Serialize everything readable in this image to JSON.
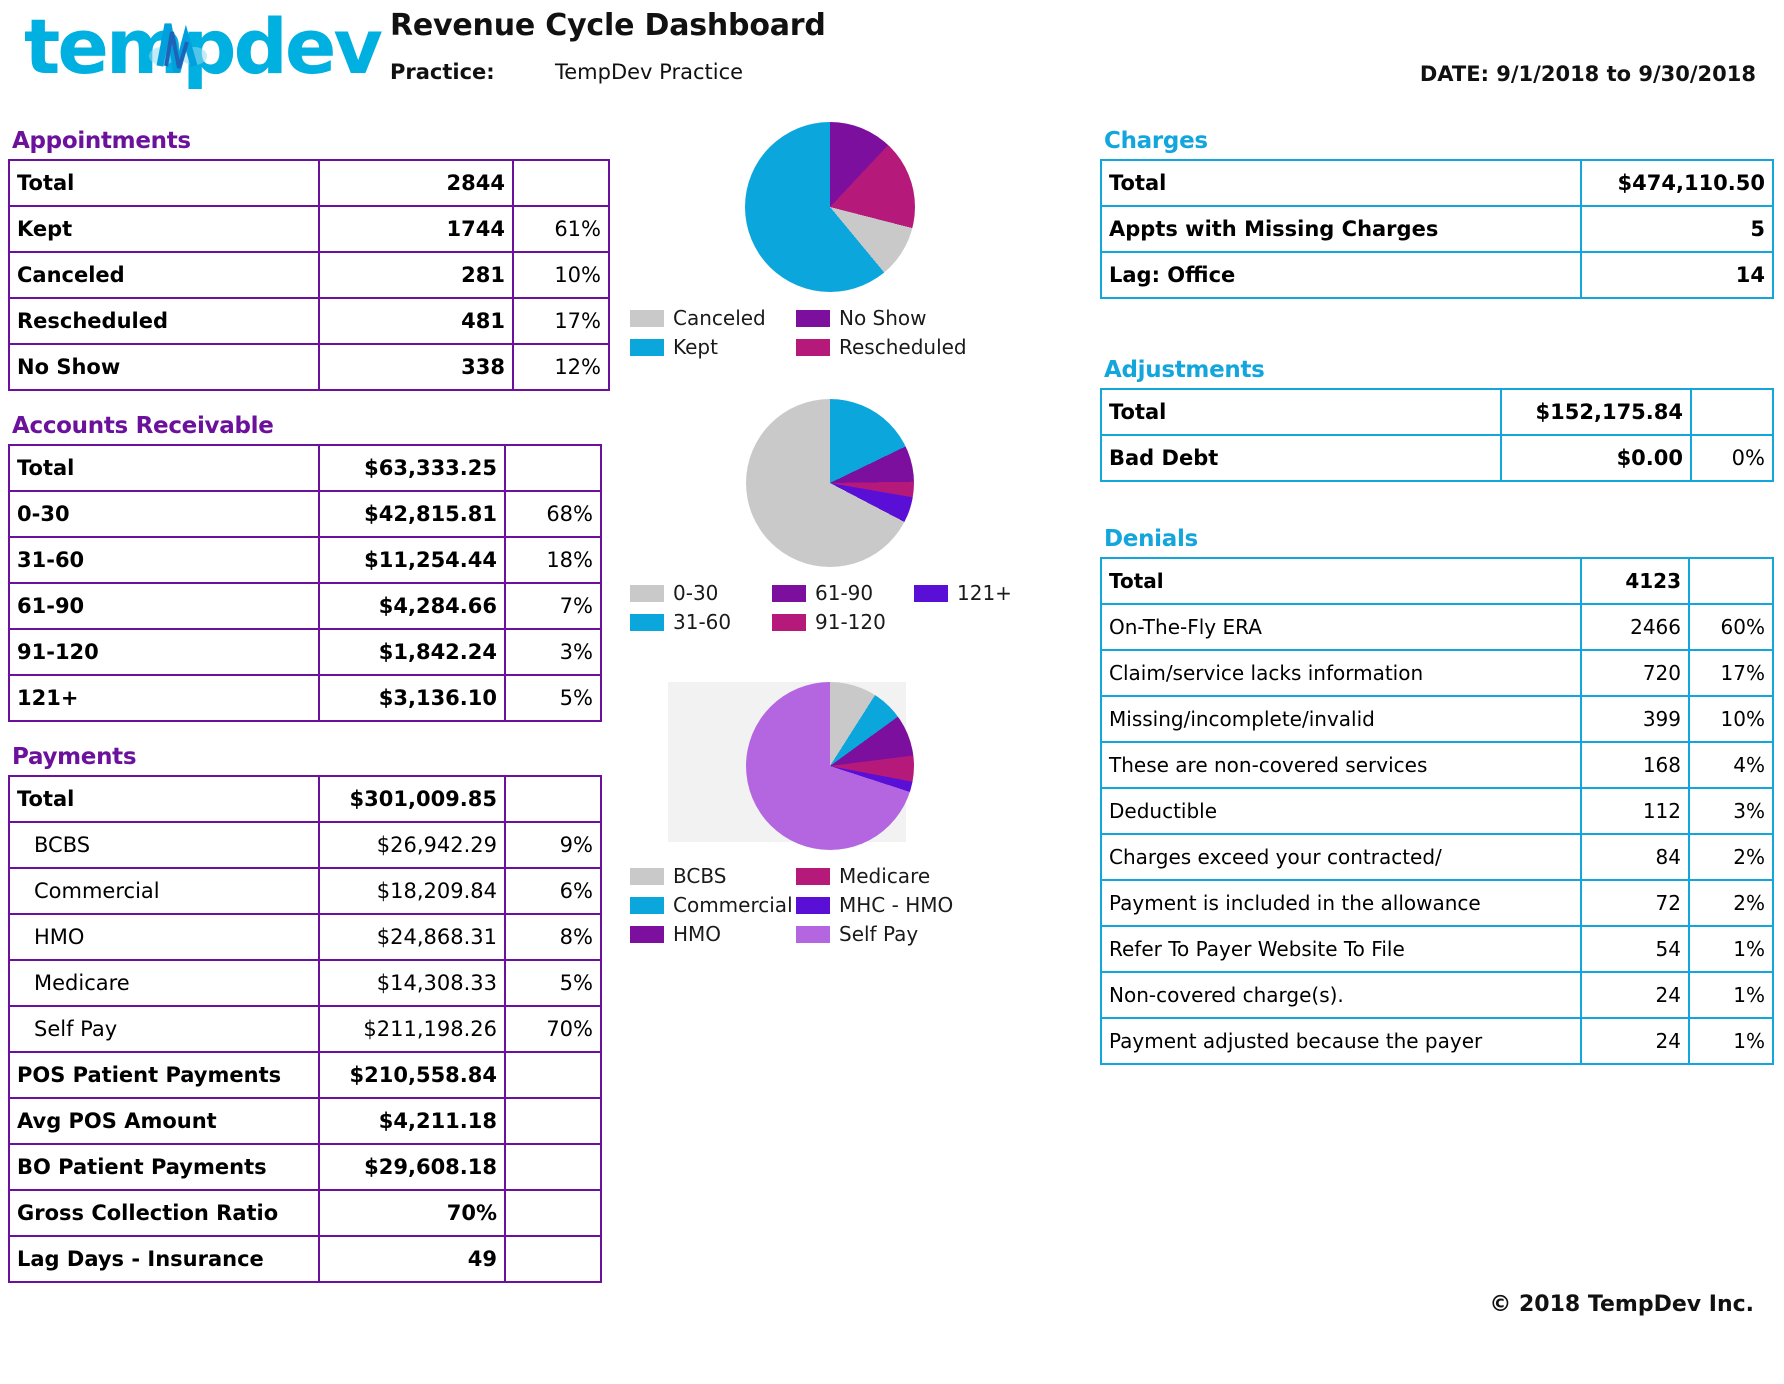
{
  "header": {
    "logo_text": "tempdev",
    "logo_icon": "heartbeat-wave-icon",
    "title": "Revenue Cycle Dashboard",
    "practice_label": "Practice:",
    "practice_value": "TempDev Practice",
    "date_range": "DATE: 9/1/2018 to 9/30/2018"
  },
  "colors": {
    "purple": "#6b119c",
    "cyan": "#13a6dd",
    "gray": "#c9c9c9",
    "magenta": "#b5197a",
    "violet": "#5a0fd6",
    "light_purple": "#b466e0",
    "hmo_purple": "#7d0f9e"
  },
  "appointments": {
    "heading": "Appointments",
    "rows": [
      {
        "label": "Total",
        "value": "2844",
        "pct": "",
        "bold": true
      },
      {
        "label": "Kept",
        "value": "1744",
        "pct": "61%",
        "bold": true
      },
      {
        "label": "Canceled",
        "value": "281",
        "pct": "10%",
        "bold": true
      },
      {
        "label": "Rescheduled",
        "value": "481",
        "pct": "17%",
        "bold": true
      },
      {
        "label": "No Show",
        "value": "338",
        "pct": "12%",
        "bold": true
      }
    ]
  },
  "accounts_receivable": {
    "heading": "Accounts Receivable",
    "rows": [
      {
        "label": "Total",
        "value": "$63,333.25",
        "pct": "",
        "bold": true
      },
      {
        "label": "0-30",
        "value": "$42,815.81",
        "pct": "68%",
        "bold": true
      },
      {
        "label": "31-60",
        "value": "$11,254.44",
        "pct": "18%",
        "bold": true
      },
      {
        "label": "61-90",
        "value": "$4,284.66",
        "pct": "7%",
        "bold": true
      },
      {
        "label": "91-120",
        "value": "$1,842.24",
        "pct": "3%",
        "bold": true
      },
      {
        "label": "121+",
        "value": "$3,136.10",
        "pct": "5%",
        "bold": true
      }
    ]
  },
  "payments": {
    "heading": "Payments",
    "rows": [
      {
        "label": "Total",
        "value": "$301,009.85",
        "pct": "",
        "bold": true,
        "indent": false
      },
      {
        "label": "BCBS",
        "value": "$26,942.29",
        "pct": "9%",
        "bold": false,
        "indent": true
      },
      {
        "label": "Commercial",
        "value": "$18,209.84",
        "pct": "6%",
        "bold": false,
        "indent": true
      },
      {
        "label": "HMO",
        "value": "$24,868.31",
        "pct": "8%",
        "bold": false,
        "indent": true
      },
      {
        "label": "Medicare",
        "value": "$14,308.33",
        "pct": "5%",
        "bold": false,
        "indent": true
      },
      {
        "label": "Self Pay",
        "value": "$211,198.26",
        "pct": "70%",
        "bold": false,
        "indent": true
      },
      {
        "label": "POS Patient Payments",
        "value": "$210,558.84",
        "pct": "",
        "bold": true,
        "indent": false
      },
      {
        "label": "Avg POS Amount",
        "value": "$4,211.18",
        "pct": "",
        "bold": true,
        "indent": false
      },
      {
        "label": "BO Patient Payments",
        "value": "$29,608.18",
        "pct": "",
        "bold": true,
        "indent": false
      },
      {
        "label": "Gross Collection Ratio",
        "value": "70%",
        "pct": "",
        "bold": true,
        "indent": false
      },
      {
        "label": "Lag Days - Insurance",
        "value": "49",
        "pct": "",
        "bold": true,
        "indent": false
      }
    ]
  },
  "charges": {
    "heading": "Charges",
    "rows": [
      {
        "label": "Total",
        "value": "$474,110.50",
        "bold": true
      },
      {
        "label": "Appts with Missing Charges",
        "value": "5",
        "bold": true
      },
      {
        "label": "Lag: Office",
        "value": "14",
        "bold": true
      }
    ]
  },
  "adjustments": {
    "heading": "Adjustments",
    "rows": [
      {
        "label": "Total",
        "value": "$152,175.84",
        "pct": "",
        "bold": true
      },
      {
        "label": "Bad Debt",
        "value": "$0.00",
        "pct": "0%",
        "bold": true
      }
    ]
  },
  "denials": {
    "heading": "Denials",
    "rows": [
      {
        "label": "Total",
        "value": "4123",
        "pct": "",
        "bold": true
      },
      {
        "label": "On-The-Fly ERA",
        "value": "2466",
        "pct": "60%",
        "bold": false
      },
      {
        "label": "Claim/service lacks information",
        "value": "720",
        "pct": "17%",
        "bold": false
      },
      {
        "label": "Missing/incomplete/invalid",
        "value": "399",
        "pct": "10%",
        "bold": false
      },
      {
        "label": "These are non-covered services",
        "value": "168",
        "pct": "4%",
        "bold": false
      },
      {
        "label": "Deductible",
        "value": "112",
        "pct": "3%",
        "bold": false
      },
      {
        "label": "Charges exceed your contracted/",
        "value": "84",
        "pct": "2%",
        "bold": false
      },
      {
        "label": "Payment is included in the allowance",
        "value": "72",
        "pct": "2%",
        "bold": false
      },
      {
        "label": "Refer To Payer Website To File",
        "value": "54",
        "pct": "1%",
        "bold": false
      },
      {
        "label": "Non-covered charge(s).",
        "value": "24",
        "pct": "1%",
        "bold": false
      },
      {
        "label": "Payment adjusted because the payer",
        "value": "24",
        "pct": "1%",
        "bold": false
      }
    ]
  },
  "footer": {
    "copyright": "© 2018 TempDev Inc."
  },
  "chart_data": [
    {
      "type": "pie",
      "name": "appointments-pie",
      "title": "",
      "categories": [
        "No Show",
        "Rescheduled",
        "Canceled",
        "Kept"
      ],
      "values": [
        12,
        17,
        10,
        61
      ],
      "raw_values": [
        338,
        481,
        281,
        1744
      ],
      "colors": [
        "#7d0f9e",
        "#b5197a",
        "#c9c9c9",
        "#0aa6dc"
      ],
      "legend": {
        "position": "bottom",
        "order": [
          "Canceled",
          "No Show",
          "Kept",
          "Rescheduled"
        ],
        "colors": {
          "Canceled": "#c9c9c9",
          "No Show": "#7d0f9e",
          "Kept": "#0aa6dc",
          "Rescheduled": "#b5197a"
        }
      }
    },
    {
      "type": "pie",
      "name": "accounts-receivable-pie",
      "title": "",
      "categories": [
        "31-60",
        "61-90",
        "91-120",
        "121+",
        "0-30"
      ],
      "values": [
        18,
        7,
        3,
        5,
        68
      ],
      "raw_values": [
        11254.44,
        4284.66,
        1842.24,
        3136.1,
        42815.81
      ],
      "colors": [
        "#0aa6dc",
        "#7d0f9e",
        "#b5197a",
        "#5a0fd6",
        "#c9c9c9"
      ],
      "legend": {
        "position": "bottom",
        "order": [
          "0-30",
          "61-90",
          "121+",
          "31-60",
          "91-120"
        ],
        "colors": {
          "0-30": "#c9c9c9",
          "61-90": "#7d0f9e",
          "121+": "#5a0fd6",
          "31-60": "#0aa6dc",
          "91-120": "#b5197a"
        }
      }
    },
    {
      "type": "pie",
      "name": "payments-pie",
      "title": "",
      "categories": [
        "BCBS",
        "Commercial",
        "HMO",
        "Medicare",
        "MHC - HMO",
        "Self Pay"
      ],
      "values": [
        9,
        6,
        8,
        5,
        2,
        70
      ],
      "raw_values": [
        26942.29,
        18209.84,
        24868.31,
        14308.33,
        0,
        211198.26
      ],
      "colors": [
        "#c9c9c9",
        "#0aa6dc",
        "#7d0f9e",
        "#b5197a",
        "#5a0fd6",
        "#b466e0"
      ],
      "legend": {
        "position": "bottom",
        "order": [
          "BCBS",
          "Medicare",
          "Commercial",
          "MHC - HMO",
          "HMO",
          "Self Pay"
        ],
        "colors": {
          "BCBS": "#c9c9c9",
          "Medicare": "#b5197a",
          "Commercial": "#0aa6dc",
          "MHC - HMO": "#5a0fd6",
          "HMO": "#7d0f9e",
          "Self Pay": "#b466e0"
        }
      }
    }
  ]
}
